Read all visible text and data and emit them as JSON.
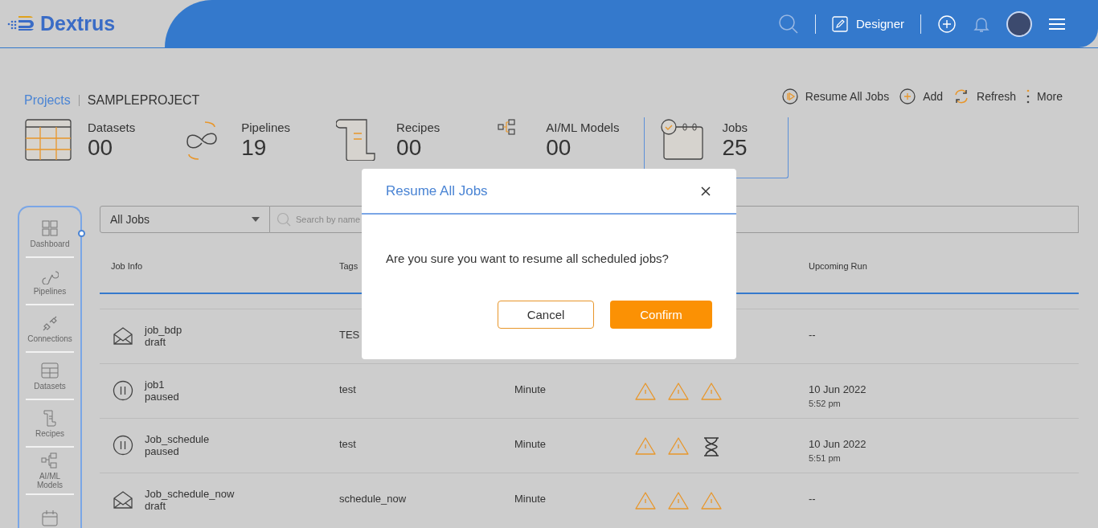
{
  "header": {
    "logo": "Dextrus",
    "designer": "Designer"
  },
  "breadcrumb": {
    "parent": "Projects",
    "current": "SAMPLEPROJECT"
  },
  "actions": [
    {
      "kind": "resume",
      "label": "Resume All Jobs"
    },
    {
      "kind": "add",
      "label": "Add"
    },
    {
      "kind": "refresh",
      "label": "Refresh"
    },
    {
      "kind": "more",
      "label": "More"
    }
  ],
  "stats": [
    {
      "kind": "datasets",
      "label": "Datasets",
      "count": "00",
      "selected": false
    },
    {
      "kind": "pipelines",
      "label": "Pipelines",
      "count": "19",
      "selected": false
    },
    {
      "kind": "recipes",
      "label": "Recipes",
      "count": "00",
      "selected": false
    },
    {
      "kind": "models",
      "label": "AI/ML Models",
      "count": "00",
      "selected": false
    },
    {
      "kind": "jobs",
      "label": "Jobs",
      "count": "25",
      "selected": true
    }
  ],
  "sidebar": {
    "items": [
      {
        "kind": "dashboard",
        "label": "Dashboard"
      },
      {
        "kind": "pipelines",
        "label": "Pipelines"
      },
      {
        "kind": "connections",
        "label": "Connections"
      },
      {
        "kind": "datasets",
        "label": "Datasets"
      },
      {
        "kind": "recipes",
        "label": "Recipes"
      },
      {
        "kind": "models",
        "label": "AI/ML Models"
      },
      {
        "kind": "jobs"
      }
    ]
  },
  "filter": {
    "value": "All Jobs",
    "placeholder": "Search by name"
  },
  "table": {
    "columns": [
      {
        "label": "Job Info"
      },
      {
        "label": "Tags"
      },
      {},
      {},
      {
        "label": "Upcoming Run"
      }
    ],
    "rows": [
      {
        "kind": "draft",
        "name": "job_bdp",
        "status": "draft",
        "tag": "TES",
        "date": "--"
      },
      {
        "kind": "paused",
        "name": "job1",
        "status": "paused",
        "tag": "test",
        "frequency": "Minute",
        "icons": [
          {
            "kind": "warning"
          },
          {
            "kind": "warning"
          },
          {
            "kind": "warning"
          }
        ],
        "date": "10 Jun 2022",
        "time": "5:52 pm"
      },
      {
        "kind": "paused",
        "name": "Job_schedule",
        "status": "paused",
        "tag": "test",
        "frequency": "Minute",
        "icons": [
          {
            "kind": "warning"
          },
          {
            "kind": "warning"
          },
          {
            "kind": "hourglass"
          }
        ],
        "date": "10 Jun 2022",
        "time": "5:51 pm"
      },
      {
        "kind": "draft",
        "name": "Job_schedule_now",
        "status": "draft",
        "tag": "schedule_now",
        "frequency": "Minute",
        "icons": [
          {
            "kind": "warning"
          },
          {
            "kind": "warning"
          },
          {
            "kind": "warning"
          }
        ],
        "date": "--"
      }
    ]
  },
  "dialog": {
    "title": "Resume All Jobs",
    "message": "Are you sure you want to resume all scheduled jobs?",
    "cancel": "Cancel",
    "confirm": "Confirm"
  }
}
